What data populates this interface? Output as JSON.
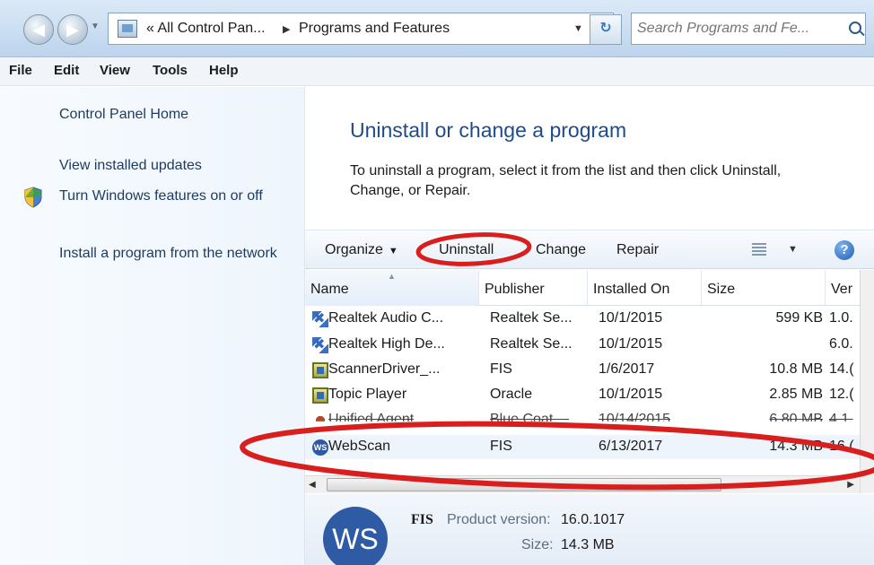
{
  "address": {
    "crumbs": [
      "« All Control Pan...",
      "Programs and Features"
    ],
    "search_placeholder": "Search Programs and Fe..."
  },
  "menu": [
    "File",
    "Edit",
    "View",
    "Tools",
    "Help"
  ],
  "left_pane": {
    "links": [
      "Control Panel Home",
      "View installed updates",
      "Turn Windows features on or off",
      "Install a program from the network"
    ]
  },
  "main": {
    "title": "Uninstall or change a program",
    "description": "To uninstall a program, select it from the list and then click Uninstall, Change, or Repair."
  },
  "toolbar": {
    "organize": "Organize",
    "uninstall": "Uninstall",
    "change": "Change",
    "repair": "Repair"
  },
  "table": {
    "columns": [
      "Name",
      "Publisher",
      "Installed On",
      "Size",
      "Ver"
    ],
    "rows": [
      {
        "name": "Realtek Audio C...",
        "publisher": "Realtek Se...",
        "installed": "10/1/2015",
        "size": "599 KB",
        "version": "1.0.",
        "icon": "realtek-icon"
      },
      {
        "name": "Realtek High De...",
        "publisher": "Realtek Se...",
        "installed": "10/1/2015",
        "size": "",
        "version": "6.0.",
        "icon": "realtek-icon"
      },
      {
        "name": "ScannerDriver_...",
        "publisher": "FIS",
        "installed": "1/6/2017",
        "size": "10.8 MB",
        "version": "14.(",
        "icon": "setup-icon"
      },
      {
        "name": "Topic Player",
        "publisher": "Oracle",
        "installed": "10/1/2015",
        "size": "2.85 MB",
        "version": "12.(",
        "icon": "setup-icon"
      },
      {
        "name": "Unified Agent",
        "publisher": "Blue Coat ...",
        "installed": "10/14/2015",
        "size": "6.80 MB",
        "version": "4.1.",
        "icon": "agent-icon"
      },
      {
        "name": "WebScan",
        "publisher": "FIS",
        "installed": "6/13/2017",
        "size": "14.3 MB",
        "version": "16.(",
        "icon": "ws-icon"
      }
    ]
  },
  "scrollbar": {
    "thumb_mark": "..."
  },
  "details": {
    "icon_text": "WS",
    "publisher": "FIS",
    "product_version_label": "Product version:",
    "product_version": "16.0.1017",
    "size_label": "Size:",
    "size": "14.3 MB"
  },
  "colors": {
    "annotation": "#d91e1e",
    "title": "#1e4b8a"
  }
}
